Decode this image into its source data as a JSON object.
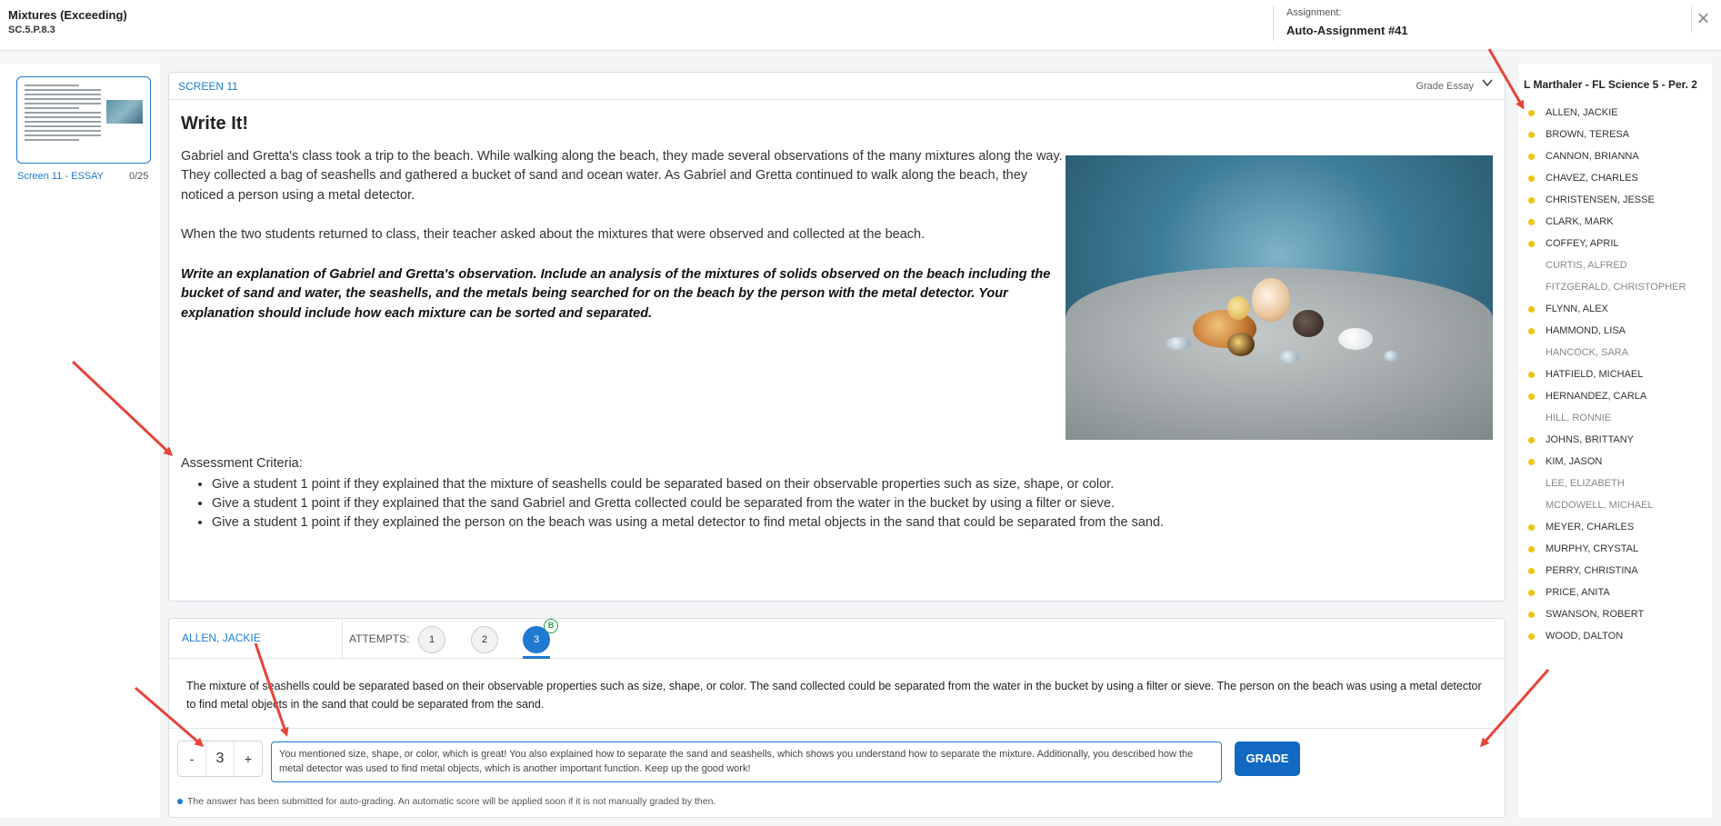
{
  "header": {
    "title": "Mixtures (Exceeding)",
    "code": "SC.5.P.8.3",
    "assignment_label": "Assignment:",
    "assignment_value": "Auto-Assignment #41",
    "close_glyph": "×"
  },
  "thumbnail": {
    "label": "Screen 11 - ESSAY",
    "score": "0/25"
  },
  "screen": {
    "name": "SCREEN 11",
    "grade_mode": "Grade Essay",
    "heading": "Write It!",
    "paragraph1": "Gabriel and Gretta's class took a trip to the beach. While walking along the beach, they made several observations of the many mixtures along the way. They collected a bag of seashells and gathered a bucket of sand and ocean water. As Gabriel and Gretta continued to walk along the beach, they noticed a person using a metal detector.",
    "paragraph2": "When the two students returned to class, their teacher asked about the mixtures that were observed and collected at the beach.",
    "prompt": "Write an explanation of Gabriel and Gretta's observation. Include an analysis of the mixtures of solids observed on the beach including the bucket of sand and water, the seashells, and the metals being searched for on the beach by the person with the metal detector. Your explanation should include how each mixture can be sorted and separated.",
    "criteria_title": "Assessment Criteria:",
    "criteria": [
      "Give a student 1 point if they explained that the mixture of seashells could be separated based on their observable properties such as size, shape, or color.",
      "Give a student 1 point if they explained that the sand Gabriel and Gretta collected could be separated from the water in the bucket by using a filter or sieve.",
      "Give a student 1 point if they explained the person on the beach was using a metal detector to find metal objects in the sand that could be separated from the sand."
    ]
  },
  "attempts": {
    "student": "ALLEN, JACKIE",
    "label": "ATTEMPTS:",
    "items": [
      "1",
      "2",
      "3"
    ],
    "active_badge": "B",
    "answer": "The mixture of seashells could be separated based on their observable properties such as size, shape, or color. The sand collected could be separated from the water in the bucket by using a filter or sieve. The person on the beach was using a metal detector to find metal objects in the sand that could be separated from the sand.",
    "score_minus": "-",
    "score_value": "3",
    "score_plus": "+",
    "feedback": "You mentioned size, shape, or color, which is great! You also explained how to separate the sand and seashells, which shows you understand how to separate the mixture. Additionally, you described how the metal detector was used to find metal objects, which is another important function. Keep up the good work!",
    "grade_button": "GRADE",
    "note": "The answer has been submitted for auto-grading. An automatic score will be applied soon if it is not manually graded by then."
  },
  "roster": {
    "title": "L Marthaler - FL Science 5 - Per. 2",
    "students": [
      {
        "name": "ALLEN, JACKIE",
        "submitted": true
      },
      {
        "name": "BROWN, TERESA",
        "submitted": true
      },
      {
        "name": "CANNON, BRIANNA",
        "submitted": true
      },
      {
        "name": "CHAVEZ, CHARLES",
        "submitted": true
      },
      {
        "name": "CHRISTENSEN, JESSE",
        "submitted": true
      },
      {
        "name": "CLARK, MARK",
        "submitted": true
      },
      {
        "name": "COFFEY, APRIL",
        "submitted": true
      },
      {
        "name": "CURTIS, ALFRED",
        "submitted": false
      },
      {
        "name": "FITZGERALD, CHRISTOPHER",
        "submitted": false
      },
      {
        "name": "FLYNN, ALEX",
        "submitted": true
      },
      {
        "name": "HAMMOND, LISA",
        "submitted": true
      },
      {
        "name": "HANCOCK, SARA",
        "submitted": false
      },
      {
        "name": "HATFIELD, MICHAEL",
        "submitted": true
      },
      {
        "name": "HERNANDEZ, CARLA",
        "submitted": true
      },
      {
        "name": "HILL, RONNIE",
        "submitted": false
      },
      {
        "name": "JOHNS, BRITTANY",
        "submitted": true
      },
      {
        "name": "KIM, JASON",
        "submitted": true
      },
      {
        "name": "LEE, ELIZABETH",
        "submitted": false
      },
      {
        "name": "MCDOWELL, MICHAEL",
        "submitted": false
      },
      {
        "name": "MEYER, CHARLES",
        "submitted": true
      },
      {
        "name": "MURPHY, CRYSTAL",
        "submitted": true
      },
      {
        "name": "PERRY, CHRISTINA",
        "submitted": true
      },
      {
        "name": "PRICE, ANITA",
        "submitted": true
      },
      {
        "name": "SWANSON, ROBERT",
        "submitted": true
      },
      {
        "name": "WOOD, DALTON",
        "submitted": true
      }
    ]
  },
  "colors": {
    "accent": "#1f7ad1",
    "submitted_dot": "#f1c40f",
    "annotation_arrow": "#e8443a",
    "badge_green": "#2c9a4a"
  }
}
